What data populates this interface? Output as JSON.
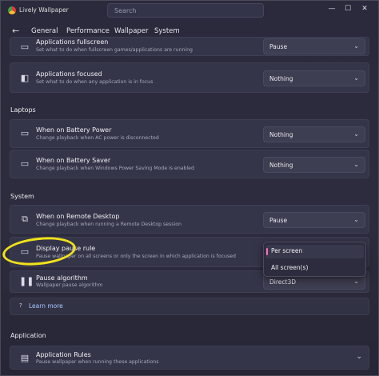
{
  "window": {
    "title": "Lively Wallpaper",
    "search_placeholder": "Search",
    "minimize": "—",
    "maximize": "☐",
    "close": "✕"
  },
  "nav": {
    "back": "←",
    "tabs": [
      "General",
      "Performance",
      "Wallpaper",
      "System"
    ],
    "active_tab": "Performance",
    "accent_color": "#ff6fb5"
  },
  "rows": {
    "fullscreen": {
      "title": "Applications fullscreen",
      "subtitle": "Set what to do when fullscreen games/applications are running",
      "value": "Pause"
    },
    "focused": {
      "title": "Applications focused",
      "subtitle": "Set what to do when any application is in focus",
      "value": "Nothing"
    },
    "battery_power": {
      "title": "When on Battery Power",
      "subtitle": "Change playback when AC power is disconnected",
      "value": "Nothing"
    },
    "battery_saver": {
      "title": "When on Battery Saver",
      "subtitle": "Change playback when Windows Power Saving Mode is enabled",
      "value": "Nothing"
    },
    "remote_desktop": {
      "title": "When on Remote Desktop",
      "subtitle": "Change playback when running a Remote Desktop session",
      "value": "Pause"
    },
    "pause_rule": {
      "title": "Display pause rule",
      "subtitle": "Pause wallpaper on all screens or only the screen in which application is focused"
    },
    "pause_algorithm": {
      "title": "Pause algorithm",
      "subtitle": "Wallpaper pause algorithm",
      "value": "Direct3D"
    },
    "app_rules": {
      "title": "Application Rules",
      "subtitle": "Pause wallpaper when running these applications"
    }
  },
  "sections": {
    "laptops": "Laptops",
    "system": "System",
    "application": "Application"
  },
  "popup": {
    "options": [
      "Per screen",
      "All screen(s)"
    ],
    "selected": "Per screen"
  },
  "learn_more": {
    "icon_text": "?",
    "label": "Learn more"
  },
  "annotation": {
    "ring_color": "#f2e21a"
  }
}
